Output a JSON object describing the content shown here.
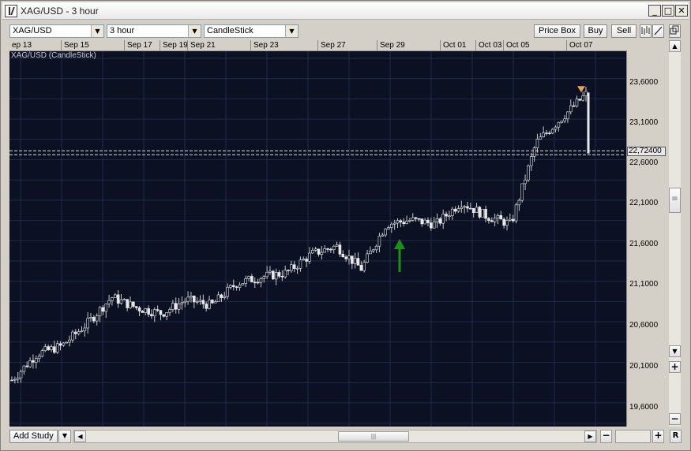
{
  "window": {
    "title": "XAG/USD - 3 hour"
  },
  "toolbar": {
    "symbol": "XAG/USD",
    "interval": "3 hour",
    "chart_type": "CandleStick",
    "price_box_label": "Price Box",
    "buy_label": "Buy",
    "sell_label": "Sell"
  },
  "chart": {
    "series_label": "XAG/USD (CandleStick)",
    "current_price_label": "22,72400",
    "date_labels": [
      "ep 13",
      "Sep 15",
      "Sep 17",
      "Sep 19",
      "Sep 21",
      "Sep 23",
      "Sep 27",
      "Sep 29",
      "Oct 01",
      "Oct 03",
      "Oct 05",
      "Oct 07"
    ],
    "price_labels": [
      "23,6000",
      "23,1000",
      "22,6000",
      "22,1000",
      "21,6000",
      "21,1000",
      "20,6000",
      "20,1000",
      "19,6000"
    ],
    "arrow_color": "#1a8f1a",
    "marker_color": "#f0a050",
    "background_color": "#0b1123"
  },
  "bottom": {
    "add_study_label": "Add Study",
    "zoom_out_label": "−",
    "zoom_in_label": "+",
    "reset_label": "R"
  },
  "chart_data": {
    "type": "candlestick",
    "series_name": "XAG/USD (CandleStick)",
    "ylim": [
      19.4,
      24.0
    ],
    "y_ticks": [
      19.6,
      20.1,
      20.6,
      21.1,
      21.6,
      22.1,
      22.6,
      23.1,
      23.6
    ],
    "current_price": 22.724,
    "close_trend": [
      {
        "x": "Sep 13",
        "close": 19.93
      },
      {
        "x": "Sep 14",
        "close": 20.25
      },
      {
        "x": "Sep 15",
        "close": 20.35
      },
      {
        "x": "Sep 16",
        "close": 20.62
      },
      {
        "x": "Sep 17",
        "close": 20.95
      },
      {
        "x": "Sep 18",
        "close": 20.82
      },
      {
        "x": "Sep 19",
        "close": 20.75
      },
      {
        "x": "Sep 20",
        "close": 20.92
      },
      {
        "x": "Sep 21",
        "close": 20.85
      },
      {
        "x": "Sep 22",
        "close": 21.12
      },
      {
        "x": "Sep 23",
        "close": 21.2
      },
      {
        "x": "Sep 24",
        "close": 21.25
      },
      {
        "x": "Sep 26",
        "close": 21.48
      },
      {
        "x": "Sep 27",
        "close": 21.58
      },
      {
        "x": "Sep 28",
        "close": 21.3
      },
      {
        "x": "Sep 29",
        "close": 21.85
      },
      {
        "x": "Sep 30",
        "close": 21.9
      },
      {
        "x": "Oct 01",
        "close": 21.85
      },
      {
        "x": "Oct 02",
        "close": 22.12
      },
      {
        "x": "Oct 03",
        "close": 21.95
      },
      {
        "x": "Oct 04",
        "close": 21.85
      },
      {
        "x": "Oct 05",
        "close": 22.85
      },
      {
        "x": "Oct 06",
        "close": 23.15
      },
      {
        "x": "Oct 07",
        "close": 23.45
      },
      {
        "x": "Oct 07 last",
        "close": 22.72
      }
    ]
  }
}
